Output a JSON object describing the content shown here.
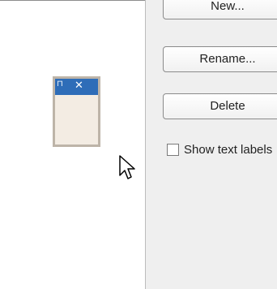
{
  "buttons": {
    "new_label": "New...",
    "rename_label": "Rename...",
    "delete_label": "Delete"
  },
  "options": {
    "show_text_labels_label": "Show text labels",
    "show_text_labels_checked": false
  },
  "preview": {
    "grip_glyph": "⊓",
    "close_glyph": "✕",
    "titlebar_color": "#2e6db8"
  },
  "icons": {
    "cursor": "mouse-pointer-icon"
  }
}
